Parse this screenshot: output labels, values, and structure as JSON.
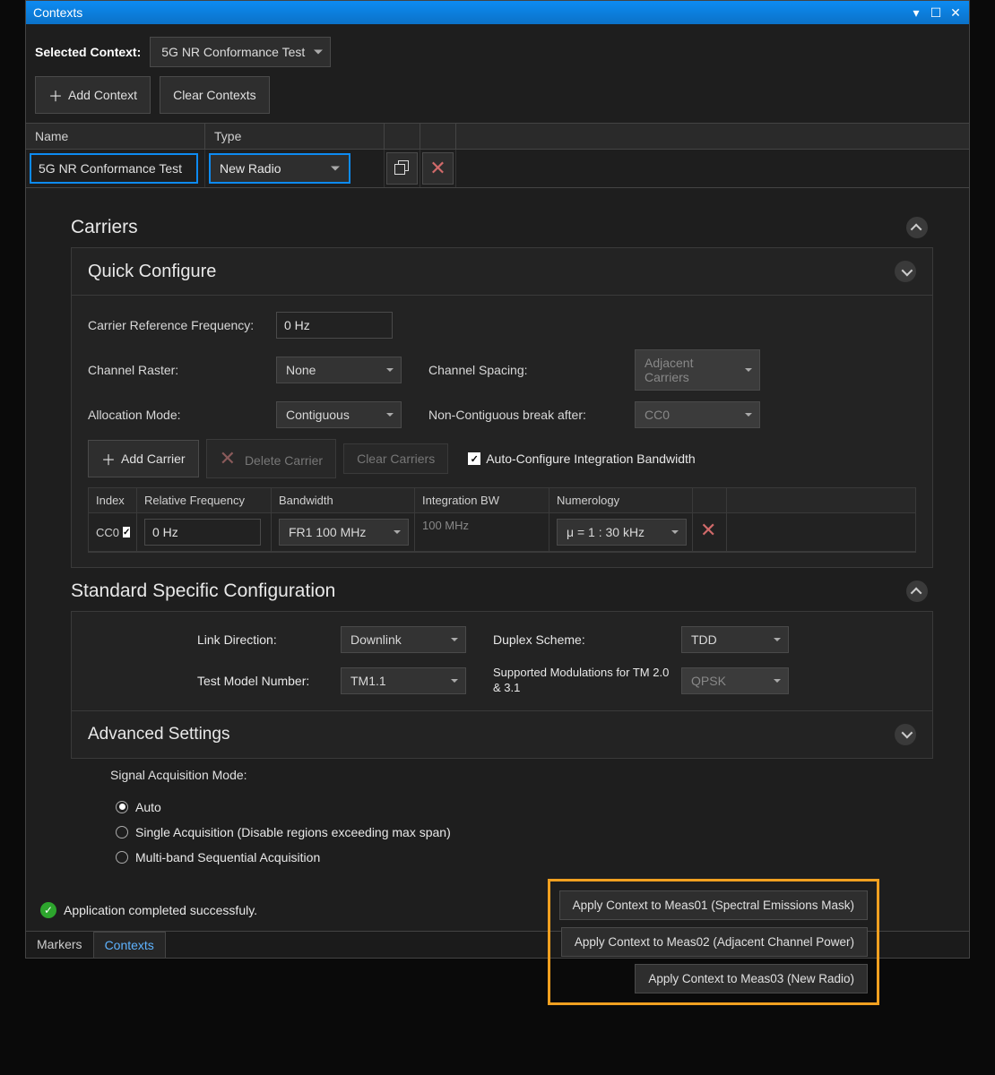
{
  "titlebar": {
    "title": "Contexts"
  },
  "selected_context": {
    "label": "Selected Context:",
    "value": "5G NR Conformance Test"
  },
  "toolbar": {
    "add_context": "Add Context",
    "clear_contexts": "Clear Contexts"
  },
  "contexts_table": {
    "headers": {
      "name": "Name",
      "type": "Type"
    },
    "row": {
      "name": "5G NR Conformance Test",
      "type": "New Radio"
    }
  },
  "carriers": {
    "title": "Carriers",
    "quick_configure": {
      "title": "Quick Configure",
      "carrier_ref_freq_label": "Carrier Reference Frequency:",
      "carrier_ref_freq_value": "0 Hz",
      "channel_raster_label": "Channel Raster:",
      "channel_raster_value": "None",
      "channel_spacing_label": "Channel Spacing:",
      "channel_spacing_value": "Adjacent Carriers",
      "allocation_mode_label": "Allocation Mode:",
      "allocation_mode_value": "Contiguous",
      "noncontig_label": "Non-Contiguous break after:",
      "noncontig_value": "CC0"
    },
    "carrier_toolbar": {
      "add": "Add Carrier",
      "delete": "Delete Carrier",
      "clear": "Clear Carriers",
      "auto_config": "Auto-Configure Integration Bandwidth"
    },
    "carrier_table": {
      "headers": {
        "index": "Index",
        "rel_freq": "Relative Frequency",
        "bandwidth": "Bandwidth",
        "integration_bw": "Integration BW",
        "numerology": "Numerology"
      },
      "row": {
        "index": "CC0",
        "rel_freq": "0 Hz",
        "bandwidth": "FR1 100 MHz",
        "integration_bw": "100 MHz",
        "numerology": "μ = 1 : 30 kHz"
      }
    }
  },
  "ssc": {
    "title": "Standard Specific Configuration",
    "link_dir_label": "Link Direction:",
    "link_dir_value": "Downlink",
    "duplex_label": "Duplex Scheme:",
    "duplex_value": "TDD",
    "tm_label": "Test Model Number:",
    "tm_value": "TM1.1",
    "mod_label": "Supported Modulations for TM 2.0 & 3.1",
    "mod_value": "QPSK"
  },
  "advanced": {
    "title": "Advanced Settings"
  },
  "signal_acq": {
    "label": "Signal Acquisition Mode:",
    "opt_auto": "Auto",
    "opt_single": "Single Acquisition (Disable regions exceeding max span)",
    "opt_multi": "Multi-band Sequential Acquisition"
  },
  "apply": {
    "meas01": "Apply Context to Meas01 (Spectral Emissions Mask)",
    "meas02": "Apply Context to Meas02 (Adjacent Channel Power)",
    "meas03": "Apply Context to Meas03 (New Radio)"
  },
  "status": "Application completed successfuly.",
  "tabs": {
    "markers": "Markers",
    "contexts": "Contexts"
  }
}
